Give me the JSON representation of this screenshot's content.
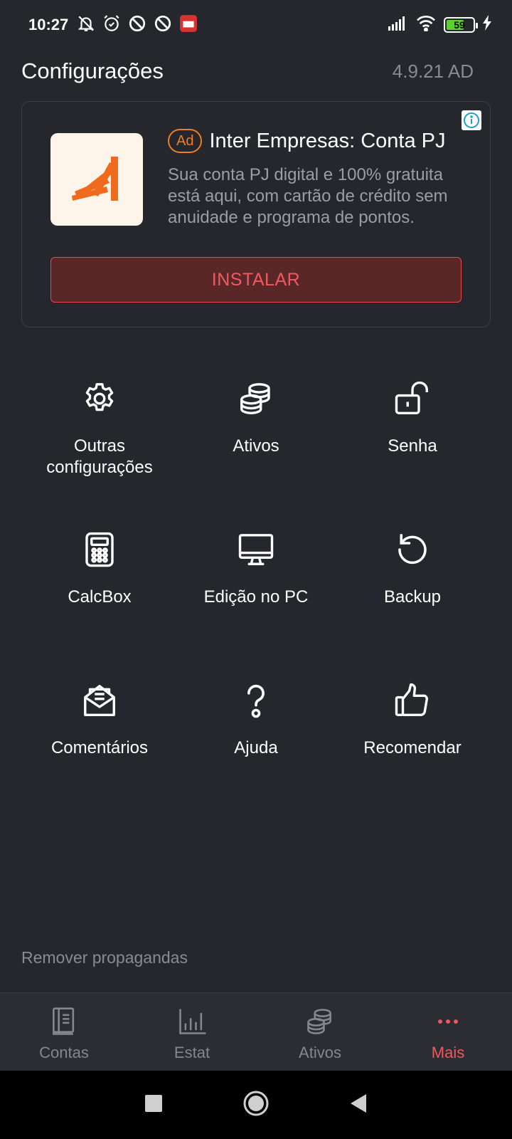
{
  "status_bar": {
    "time": "10:27",
    "battery": "59"
  },
  "header": {
    "title": "Configurações",
    "version": "4.9.21 AD"
  },
  "ad": {
    "badge": "Ad",
    "title": "Inter Empresas: Conta PJ",
    "description": "Sua conta PJ digital e 100% gratuita está aqui, com cartão de crédito sem anuidade e programa de pontos.",
    "button": "INSTALAR",
    "accent_color": "#f07d1f"
  },
  "menu": [
    {
      "label": "Outras configurações",
      "icon": "gear-icon"
    },
    {
      "label": "Ativos",
      "icon": "coins-icon"
    },
    {
      "label": "Senha",
      "icon": "unlock-icon"
    },
    {
      "label": "CalcBox",
      "icon": "calculator-icon"
    },
    {
      "label": "Edição no PC",
      "icon": "monitor-icon"
    },
    {
      "label": "Backup",
      "icon": "restore-icon"
    },
    {
      "label": "Comentários",
      "icon": "mail-open-icon"
    },
    {
      "label": "Ajuda",
      "icon": "question-icon"
    },
    {
      "label": "Recomendar",
      "icon": "thumbs-up-icon"
    }
  ],
  "remove_ads": "Remover propagandas",
  "bottom_nav": [
    {
      "label": "Contas",
      "icon": "book-icon"
    },
    {
      "label": "Estat",
      "icon": "bar-chart-icon"
    },
    {
      "label": "Ativos",
      "icon": "coins-icon"
    },
    {
      "label": "Mais",
      "icon": "more-dots-icon"
    }
  ],
  "active_color": "#f0585b"
}
